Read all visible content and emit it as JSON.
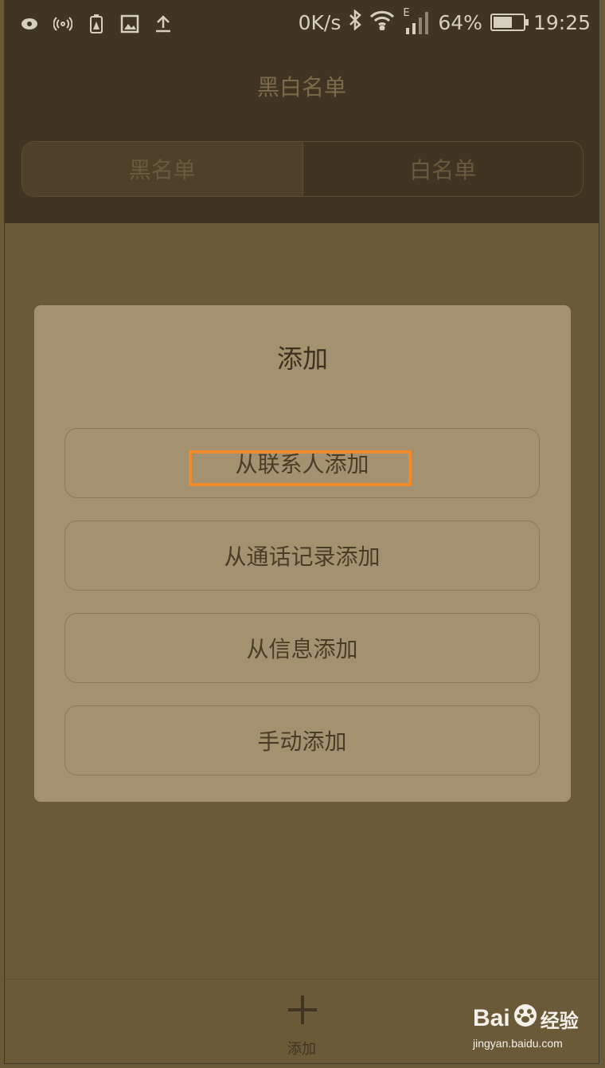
{
  "status_bar": {
    "left_icons": [
      "eye-icon",
      "hotspot-icon",
      "battery-warning-icon",
      "image-icon",
      "upload-icon"
    ],
    "net_speed": "0K/s",
    "signal_type": "E",
    "battery_percent": "64%",
    "battery_level": 0.64,
    "time": "19:25"
  },
  "header": {
    "title": "黑白名单",
    "tabs": [
      {
        "label": "黑名单",
        "active": true
      },
      {
        "label": "白名单",
        "active": false
      }
    ]
  },
  "dialog": {
    "title": "添加",
    "options": [
      {
        "label": "从联系人添加"
      },
      {
        "label": "从通话记录添加"
      },
      {
        "label": "从信息添加"
      },
      {
        "label": "手动添加"
      }
    ]
  },
  "bottom_bar": {
    "add_label": "添加"
  },
  "watermark": {
    "brand": "Bai",
    "brand_suffix": "经验",
    "url": "jingyan.baidu.com"
  },
  "colors": {
    "header_bg": "#3f3522",
    "content_bg": "#6a5a38",
    "dialog_bg": "#a39170",
    "highlight": "#f08a2c"
  }
}
